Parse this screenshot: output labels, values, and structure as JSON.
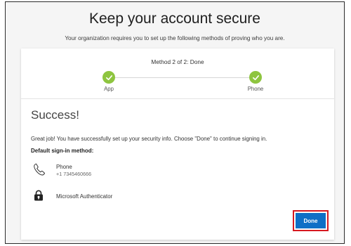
{
  "page": {
    "title": "Keep your account secure",
    "subtitle": "Your organization requires you to set up the following methods of proving who you are."
  },
  "wizard": {
    "step_title": "Method 2 of 2: Done",
    "steps": [
      {
        "label": "App",
        "state": "complete",
        "icon": "checkmark-icon"
      },
      {
        "label": "Phone",
        "state": "complete",
        "icon": "checkmark-icon"
      }
    ]
  },
  "result": {
    "heading": "Success!",
    "message": "Great job! You have successfully set up your security info. Choose \"Done\" to continue signing in.",
    "default_method_label": "Default sign-in method:",
    "methods": [
      {
        "icon": "phone-icon",
        "name": "Phone",
        "detail": "+1 7345460666"
      },
      {
        "icon": "authenticator-lock-icon",
        "name": "Microsoft Authenticator"
      }
    ]
  },
  "actions": {
    "done_label": "Done",
    "done_highlight": "red-outline"
  },
  "colors": {
    "step_complete": "#8ec53f",
    "primary_button": "#0f6fc6",
    "highlight_border": "#d71920"
  }
}
